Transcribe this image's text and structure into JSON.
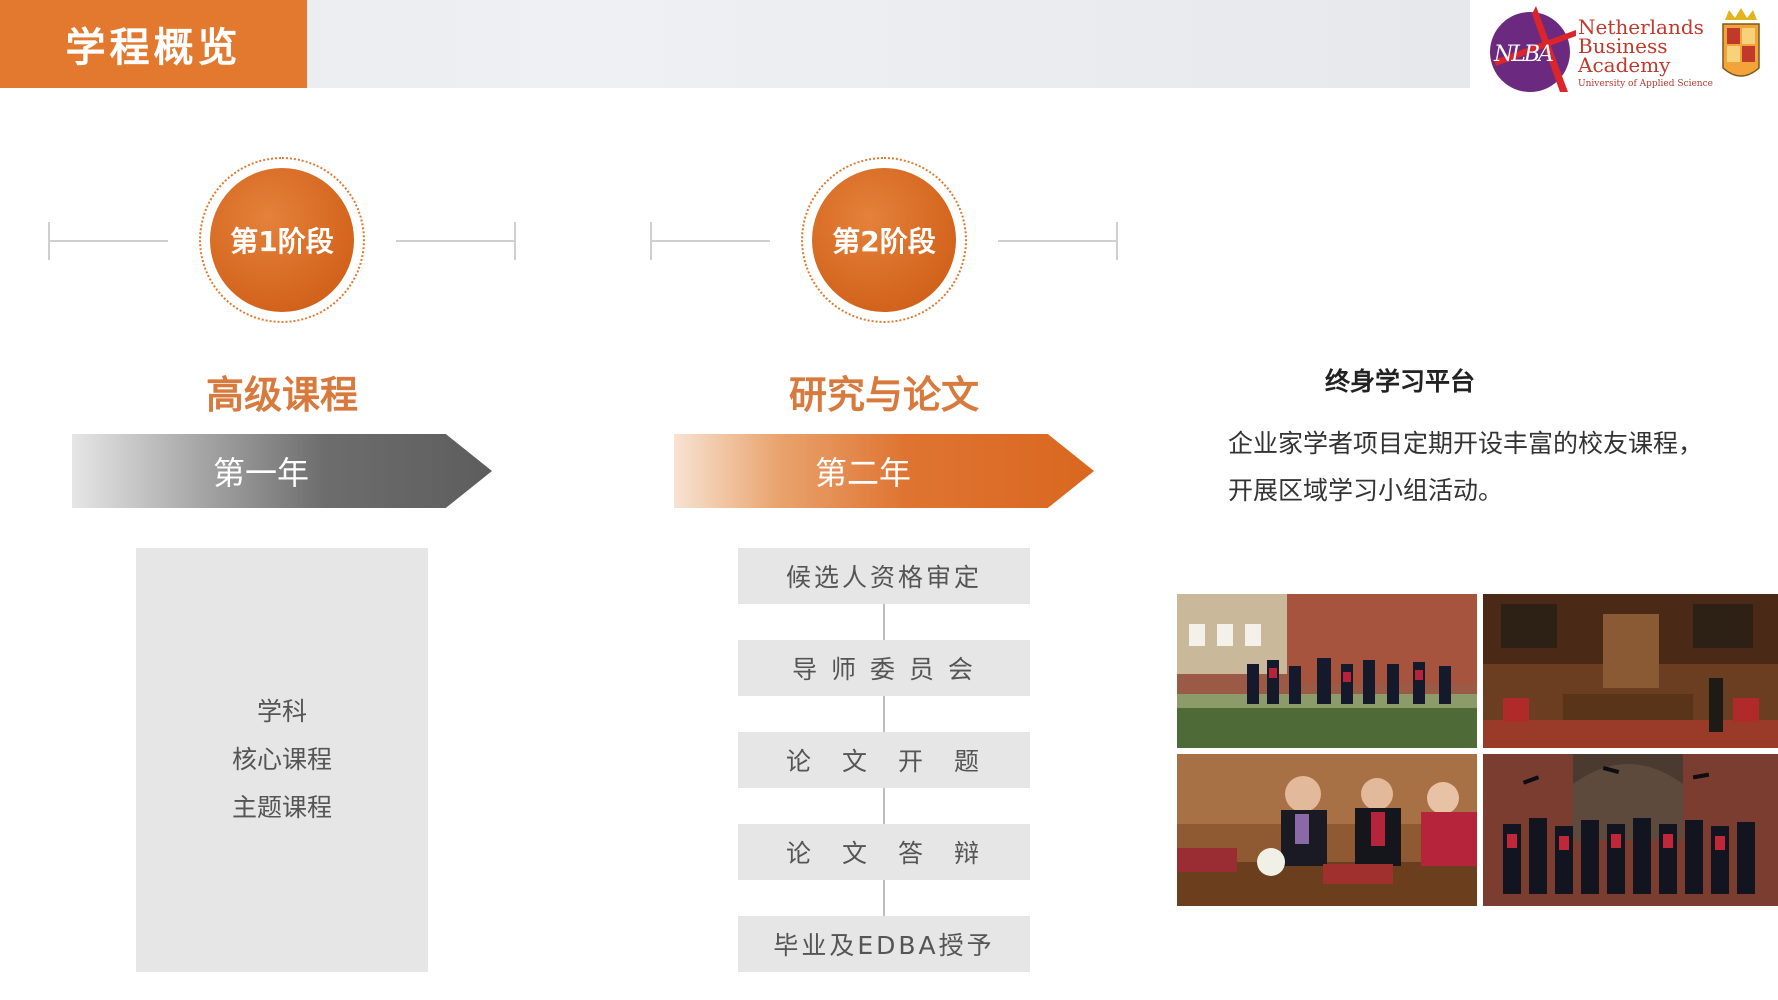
{
  "header": {
    "title": "学程概览"
  },
  "logo": {
    "initials": "NLBA",
    "line1": "Netherlands",
    "line2": "Business",
    "line3": "Academy",
    "subtitle": "University of Applied Science"
  },
  "stages": [
    {
      "badge": "第1阶段",
      "title": "高级课程",
      "year": "第一年"
    },
    {
      "badge": "第2阶段",
      "title": "研究与论文",
      "year": "第二年"
    }
  ],
  "year1_courses": [
    "学科",
    "核心课程",
    "主题课程"
  ],
  "year2_steps": [
    "候选人资格审定",
    "导 师 委 员 会",
    "论　文　开　题",
    "论　文　答　辩",
    "毕业及EDBA授予"
  ],
  "lifelong": {
    "title": "终身学习平台",
    "line1": "企业家学者项目定期开设丰富的校友课程，",
    "line2": "开展区域学习小组活动。"
  },
  "colors": {
    "accent": "#e3782f",
    "dark_orange": "#d3641d",
    "gray_box": "#e6e6e6"
  }
}
